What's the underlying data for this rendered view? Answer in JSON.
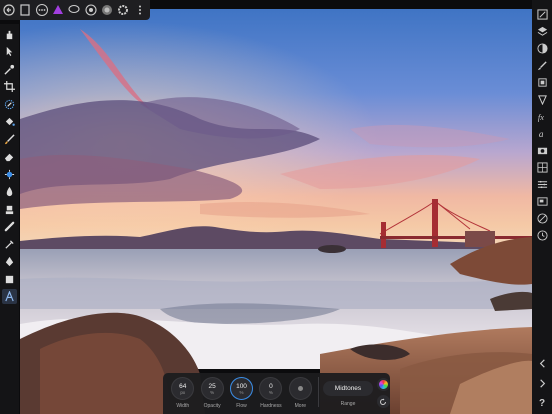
{
  "top_toolbar": {
    "icons": [
      "home-icon",
      "document-icon",
      "more-icon",
      "persona-icon",
      "lasso-icon",
      "color-icon",
      "layers-icon",
      "settings-icon",
      "overflow-icon"
    ]
  },
  "left_tools": [
    "hand-icon",
    "move-icon",
    "color-picker-icon",
    "crop-icon",
    "selection-brush-icon",
    "flood-fill-icon",
    "paint-brush-icon",
    "eraser-icon",
    "dodge-icon",
    "smudge-icon",
    "clone-icon",
    "healing-icon",
    "retouch-icon",
    "pen-icon",
    "rectangle-icon",
    "text-icon"
  ],
  "right_panels": [
    "history-icon",
    "layers-icon",
    "brushes-icon",
    "adjustments-icon",
    "effects-icon",
    "styles-icon",
    "fx-icon",
    "text-icon",
    "camera-icon",
    "stock-icon",
    "channels-icon",
    "navigator-icon",
    "transform-icon",
    "clock-icon"
  ],
  "right_bottom": [
    "chevron-left-icon",
    "chevron-right-icon",
    "help-icon"
  ],
  "help_label": "?",
  "context": {
    "width": {
      "value": "64",
      "unit": "px",
      "label": "Width"
    },
    "opacity": {
      "value": "25",
      "unit": "%",
      "label": "Opacity"
    },
    "flow": {
      "value": "100",
      "unit": "%",
      "label": "Flow"
    },
    "hardness": {
      "value": "0",
      "unit": "%",
      "label": "Hardness"
    },
    "more": {
      "label": "More"
    },
    "range": {
      "value": "Midtones",
      "label": "Range"
    }
  },
  "colors": {
    "accent": "#3b8ee8",
    "panel": "#141416",
    "toolbar": "#1e1e21"
  }
}
